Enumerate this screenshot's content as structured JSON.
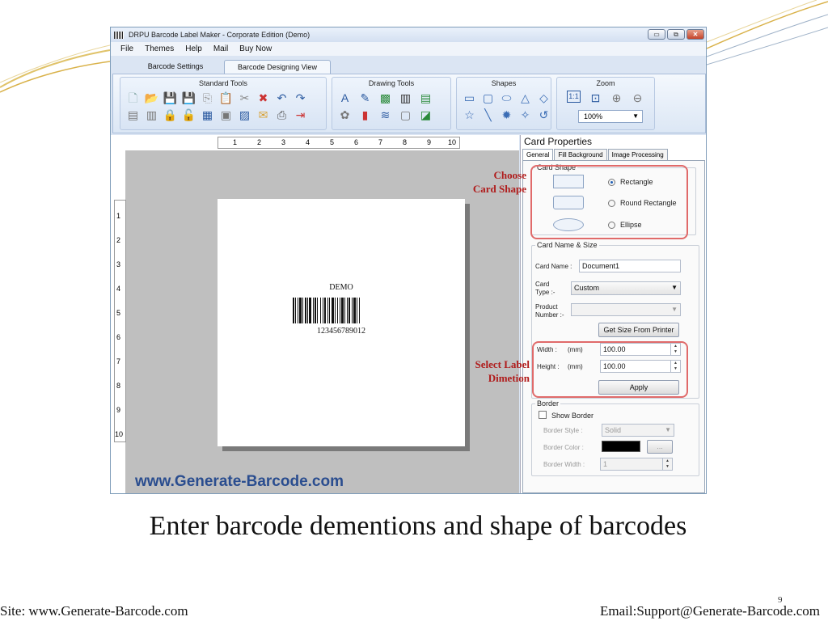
{
  "window": {
    "title": "DRPU Barcode Label Maker - Corporate Edition (Demo)",
    "buttons": [
      "▭",
      "⧉",
      "✕"
    ]
  },
  "menu": [
    "File",
    "Themes",
    "Help",
    "Mail",
    "Buy Now"
  ],
  "tabs": [
    "Barcode Settings",
    "Barcode Designing View"
  ],
  "ribbon": {
    "groups": [
      "Standard Tools",
      "Drawing Tools",
      "Shapes",
      "Zoom"
    ],
    "zoom_value": "100%"
  },
  "ruler": {
    "top": [
      "1",
      "2",
      "3",
      "4",
      "5",
      "6",
      "7",
      "8",
      "9",
      "10"
    ],
    "left": [
      "1",
      "2",
      "3",
      "4",
      "5",
      "6",
      "7",
      "8",
      "9",
      "10"
    ]
  },
  "card": {
    "label_text": "DEMO",
    "barcode_number": "123456789012"
  },
  "watermark_site": "www.Generate-Barcode.com",
  "properties": {
    "title": "Card Properties",
    "tabs": [
      "General",
      "Fill Background",
      "Image Processing"
    ],
    "card_shape": {
      "legend": "Card Shape",
      "options": [
        "Rectangle",
        "Round Rectangle",
        "Ellipse"
      ],
      "selected": "Rectangle"
    },
    "name_size": {
      "legend": "Card  Name & Size",
      "card_name_label": "Card Name :",
      "card_name_value": "Document1",
      "card_type_label_1": "Card",
      "card_type_label_2": "Type :-",
      "card_type_value": "Custom",
      "product_label_1": "Product",
      "product_label_2": "Number :-",
      "product_value": "",
      "get_size_button": "Get Size From Printer",
      "width_label": "Width :",
      "width_unit": "(mm)",
      "width_value": "100.00",
      "height_label": "Height :",
      "height_unit": "(mm)",
      "height_value": "100.00",
      "apply_button": "Apply"
    },
    "border": {
      "legend": "Border",
      "show_border": "Show Border",
      "show_border_checked": false,
      "style_label": "Border Style :",
      "style_value": "Solid",
      "color_label": "Border Color :",
      "color_value": "#000000",
      "color_button": "...",
      "width_label": "Border Width :",
      "width_value": "1"
    }
  },
  "annotations": {
    "choose_line1": "Choose",
    "choose_line2": "Card Shape",
    "select_line1": "Select Label",
    "select_line2": "Dimetion"
  },
  "caption": "Enter barcode  dementions and shape of barcodes",
  "footer": {
    "site": "Site: www.Generate-Barcode.com",
    "email": "Email:Support@Generate-Barcode.com",
    "page_number": "9"
  }
}
